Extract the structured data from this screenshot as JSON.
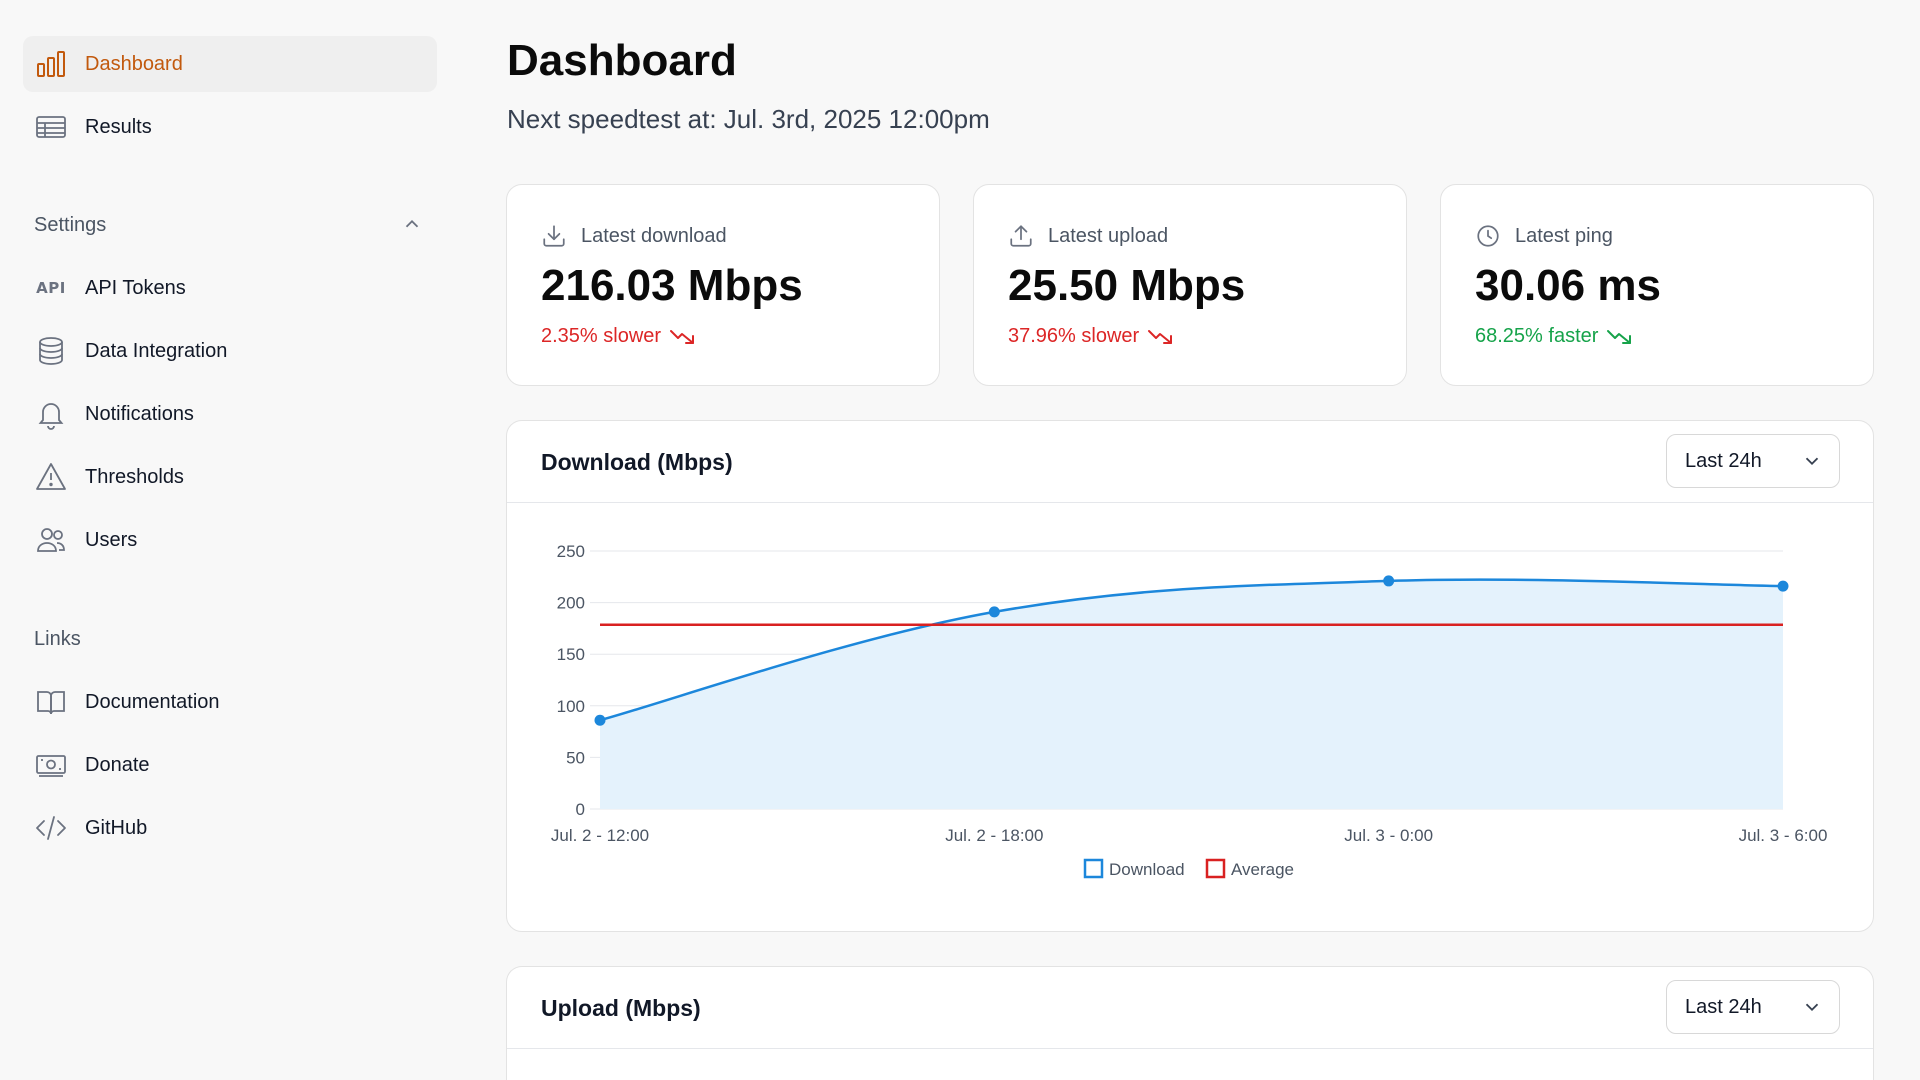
{
  "sidebar": {
    "items": [
      {
        "label": "Dashboard",
        "icon": "bar-chart-icon",
        "active": true
      },
      {
        "label": "Results",
        "icon": "table-icon",
        "active": false
      }
    ],
    "settings": {
      "label": "Settings",
      "items": [
        {
          "label": "API Tokens",
          "icon": "api-icon",
          "glyph": "API"
        },
        {
          "label": "Data Integration",
          "icon": "database-icon"
        },
        {
          "label": "Notifications",
          "icon": "bell-icon"
        },
        {
          "label": "Thresholds",
          "icon": "warning-icon"
        },
        {
          "label": "Users",
          "icon": "users-icon"
        }
      ]
    },
    "links": {
      "label": "Links",
      "items": [
        {
          "label": "Documentation",
          "icon": "book-icon"
        },
        {
          "label": "Donate",
          "icon": "banknote-icon"
        },
        {
          "label": "GitHub",
          "icon": "code-icon"
        }
      ]
    }
  },
  "main": {
    "title": "Dashboard",
    "subtitle": "Next speedtest at: Jul. 3rd, 2025 12:00pm",
    "stats": [
      {
        "label": "Latest download",
        "value": "216.03 Mbps",
        "delta": "2.35% slower",
        "trend": "down",
        "color": "#dc2626"
      },
      {
        "label": "Latest upload",
        "value": "25.50 Mbps",
        "delta": "37.96% slower",
        "trend": "down",
        "color": "#dc2626"
      },
      {
        "label": "Latest ping",
        "value": "30.06 ms",
        "delta": "68.25% faster",
        "trend": "down",
        "color": "#16a34a"
      }
    ],
    "download_card": {
      "title": "Download (Mbps)",
      "range": "Last 24h"
    },
    "upload_card": {
      "title": "Upload (Mbps)",
      "range": "Last 24h"
    }
  },
  "colors": {
    "accent": "#c2590d",
    "download_line": "#1c87db",
    "download_fill": "#e4f2fc",
    "average_line": "#d92121"
  },
  "chart_data": {
    "type": "line",
    "title": "Download (Mbps)",
    "x": [
      "Jul. 2 - 12:00",
      "Jul. 2 - 18:00",
      "Jul. 3 - 0:00",
      "Jul. 3 - 6:00"
    ],
    "series": [
      {
        "name": "Download",
        "values": [
          86,
          191,
          221,
          216
        ]
      },
      {
        "name": "Average",
        "values": [
          178.5,
          178.5,
          178.5,
          178.5
        ]
      }
    ],
    "yticks": [
      0,
      50,
      100,
      150,
      200,
      250
    ],
    "ylim": [
      0,
      250
    ],
    "grid": true,
    "legend": "bottom-center",
    "fill_under": "Download"
  }
}
